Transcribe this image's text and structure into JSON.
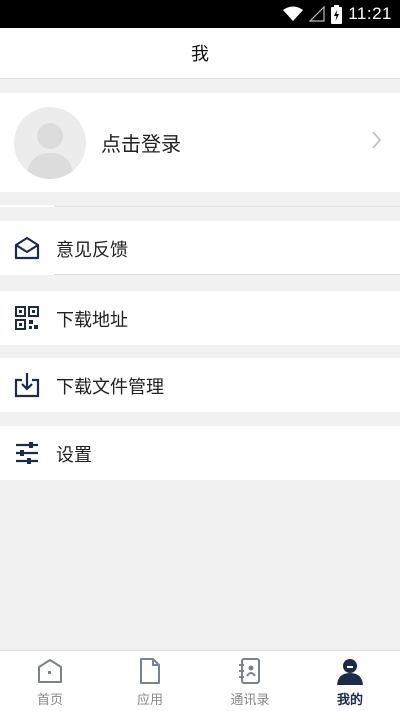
{
  "status_bar": {
    "time": "11:21",
    "icons": [
      "wifi-icon",
      "signal-icon",
      "battery-icon"
    ]
  },
  "header": {
    "title": "我"
  },
  "profile": {
    "login_text": "点击登录"
  },
  "menu": [
    {
      "icon": "mail-icon",
      "label": "意见反馈"
    },
    {
      "icon": "qrcode-icon",
      "label": "下载地址"
    },
    {
      "icon": "download-icon",
      "label": "下载文件管理"
    },
    {
      "icon": "sliders-icon",
      "label": "设置"
    }
  ],
  "tabs": [
    {
      "icon": "home-icon",
      "label": "首页",
      "active": false
    },
    {
      "icon": "document-icon",
      "label": "应用",
      "active": false
    },
    {
      "icon": "contacts-icon",
      "label": "通讯录",
      "active": false
    },
    {
      "icon": "user-icon",
      "label": "我的",
      "active": true
    }
  ],
  "colors": {
    "accent": "#1d2b4a",
    "background": "#f1f1f1"
  }
}
